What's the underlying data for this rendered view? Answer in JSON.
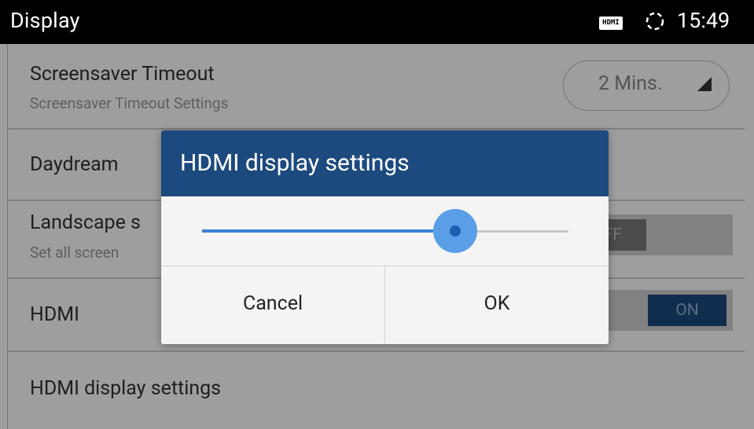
{
  "statusbar": {
    "title": "Display",
    "hdmi_icon_text": "HDMI",
    "sync_icon": "sync-icon",
    "time": "15:49"
  },
  "settings": {
    "screensaver": {
      "label": "Screensaver Timeout",
      "sub": "Screensaver Timeout Settings",
      "value": "2 Mins."
    },
    "daydream": {
      "label": "Daydream"
    },
    "landscape": {
      "label": "Landscape s",
      "sub": "Set all screen",
      "toggle_text": "OFF"
    },
    "hdmi": {
      "label": "HDMI",
      "toggle_text": "ON"
    },
    "hdmi_display": {
      "label": "HDMI display settings"
    }
  },
  "dialog": {
    "title": "HDMI display settings",
    "slider_fraction": 0.69,
    "cancel_label": "Cancel",
    "ok_label": "OK"
  },
  "colors": {
    "dialog_title_bg": "#1c4a7e",
    "slider_accent": "#3c83d0",
    "toggle_on": "#1c4a7e"
  }
}
